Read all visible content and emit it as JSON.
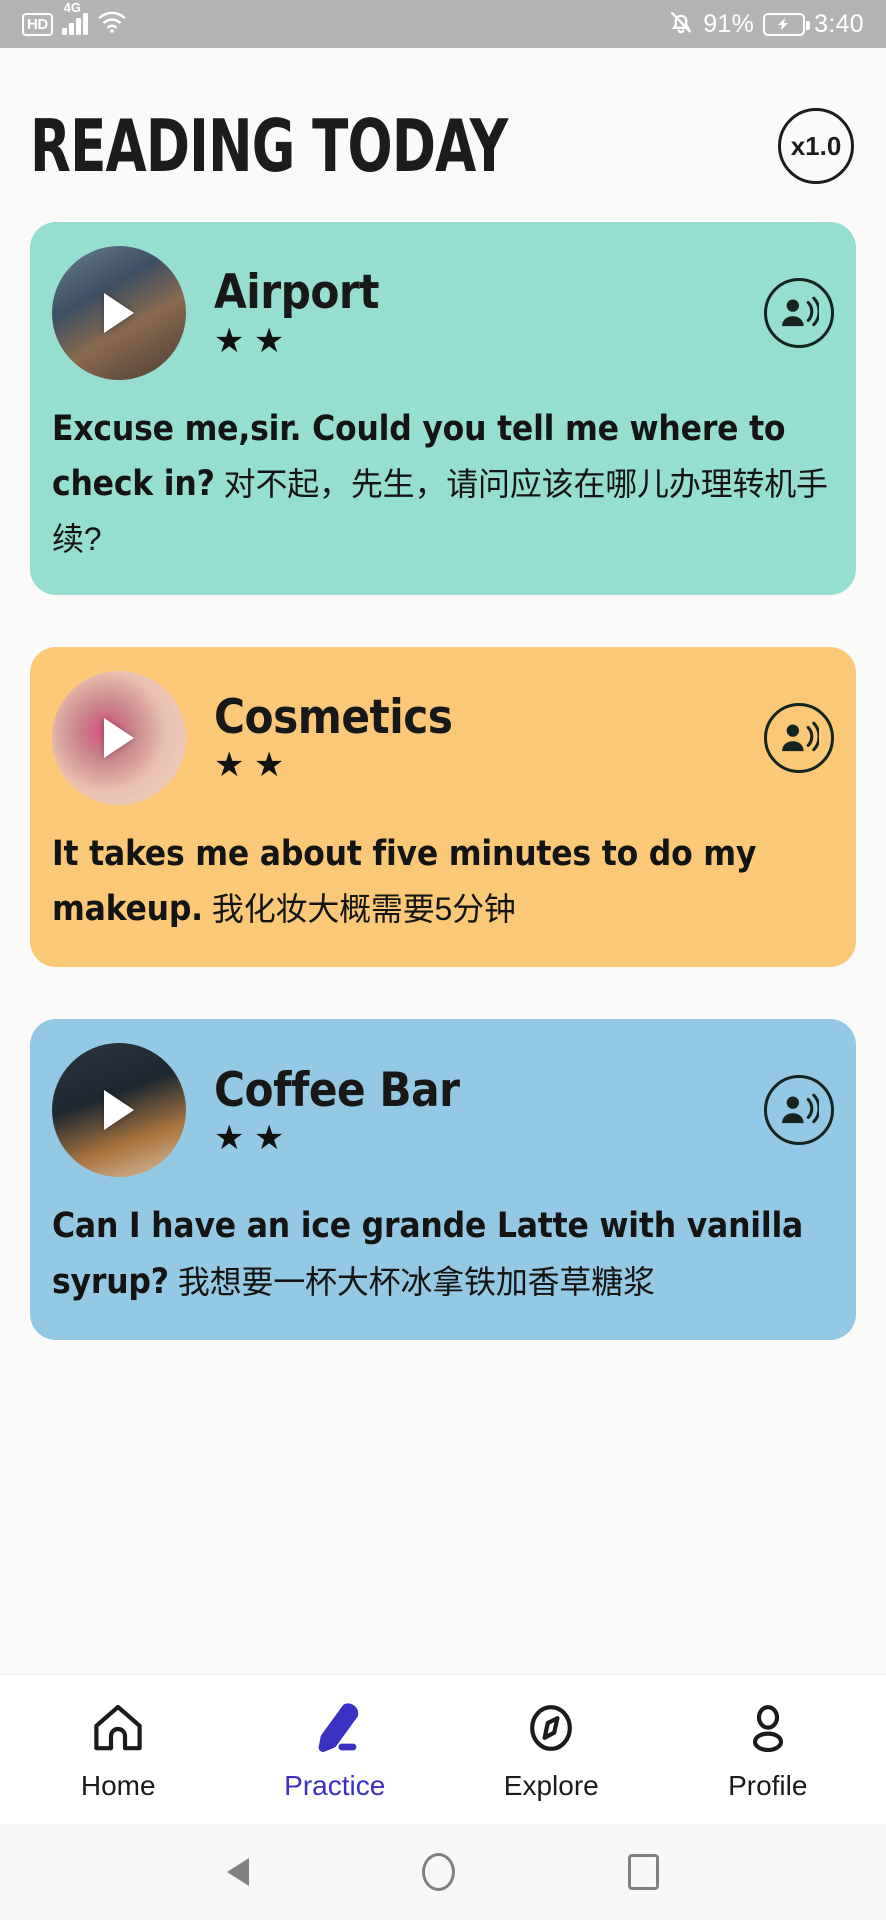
{
  "statusbar": {
    "hd_badge": "HD",
    "network_label": "4G",
    "battery_percent": "91%",
    "clock": "3:40",
    "icons": [
      "mute-bell-icon",
      "wifi-icon",
      "signal-bars-icon",
      "battery-charging-icon"
    ]
  },
  "header": {
    "title": "READING TODAY",
    "speed_button": "x1.0"
  },
  "cards": [
    {
      "title": "Airport",
      "stars": "★ ★",
      "english": "Excuse me,sir. Could you tell me where to check in?",
      "chinese": "对不起，先生，请问应该在哪儿办理转机手续?",
      "color": "#95ded0",
      "thumb_alt": "airport-traveler-photo"
    },
    {
      "title": "Cosmetics",
      "stars": "★ ★",
      "english": "It takes me about five minutes to do my makeup.",
      "chinese": "我化妆大概需要5分钟",
      "color": "#fbc878",
      "thumb_alt": "mascara-eye-photo"
    },
    {
      "title": "Coffee Bar",
      "stars": "★ ★",
      "english": "Can I have an ice grande Latte with vanilla syrup?",
      "chinese": "我想要一杯大杯冰拿铁加香草糖浆",
      "color": "#93c9e5",
      "thumb_alt": "latte-pour-photo"
    }
  ],
  "bottomnav": {
    "active_index": 1,
    "items": [
      {
        "label": "Home",
        "icon": "home-icon"
      },
      {
        "label": "Practice",
        "icon": "pen-icon"
      },
      {
        "label": "Explore",
        "icon": "compass-icon"
      },
      {
        "label": "Profile",
        "icon": "person-icon"
      }
    ]
  },
  "androidnav": {
    "back": "back-triangle-icon",
    "home": "home-circle-icon",
    "recents": "recents-square-icon"
  },
  "colors": {
    "accent": "#3b30c4",
    "page_bg": "#fafaf8",
    "statusbar_bg": "#b4b4b4"
  }
}
